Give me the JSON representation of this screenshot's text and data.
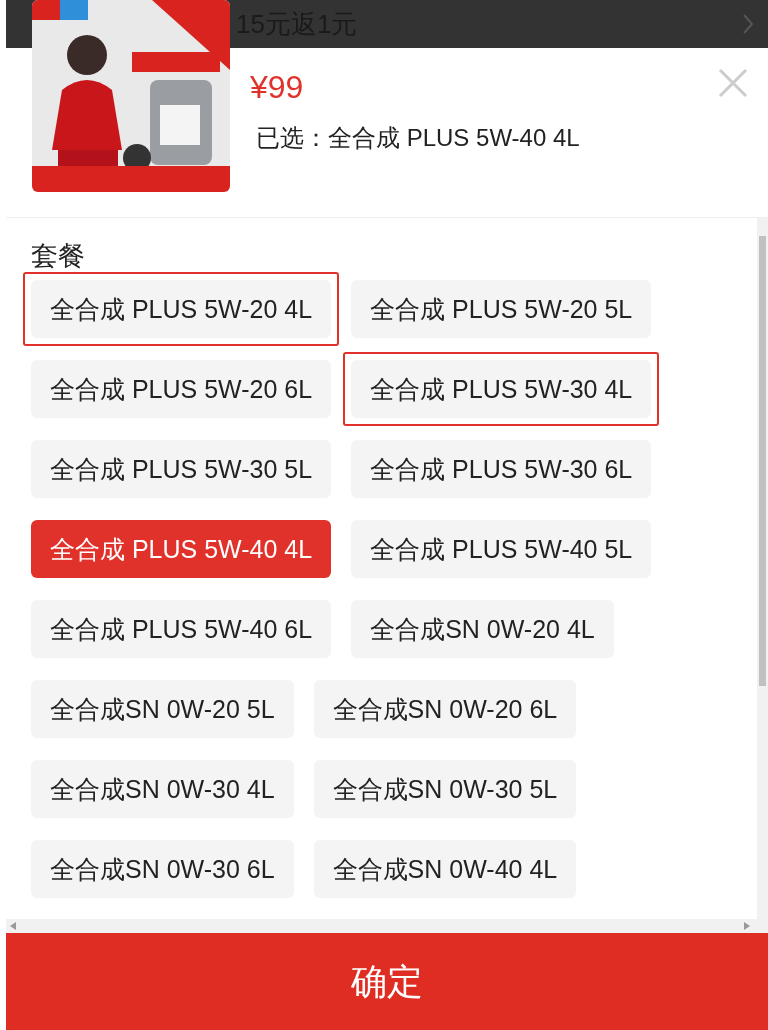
{
  "banner": {
    "text": "15元返1元"
  },
  "product": {
    "price": "¥99",
    "selected_text": "已选：全合成 PLUS 5W-40 4L"
  },
  "section_title": "套餐",
  "options": [
    {
      "label": "全合成 PLUS 5W-20 4L",
      "selected": false,
      "annotated": true
    },
    {
      "label": "全合成 PLUS 5W-20 5L",
      "selected": false,
      "annotated": false
    },
    {
      "label": "全合成 PLUS 5W-20 6L",
      "selected": false,
      "annotated": false
    },
    {
      "label": "全合成 PLUS 5W-30 4L",
      "selected": false,
      "annotated": true
    },
    {
      "label": "全合成 PLUS 5W-30 5L",
      "selected": false,
      "annotated": false
    },
    {
      "label": "全合成 PLUS 5W-30 6L",
      "selected": false,
      "annotated": false
    },
    {
      "label": "全合成 PLUS 5W-40 4L",
      "selected": true,
      "annotated": false
    },
    {
      "label": "全合成 PLUS 5W-40 5L",
      "selected": false,
      "annotated": false
    },
    {
      "label": "全合成 PLUS 5W-40 6L",
      "selected": false,
      "annotated": false
    },
    {
      "label": "全合成SN 0W-20 4L",
      "selected": false,
      "annotated": false
    },
    {
      "label": "全合成SN 0W-20 5L",
      "selected": false,
      "annotated": false
    },
    {
      "label": "全合成SN 0W-20 6L",
      "selected": false,
      "annotated": false
    },
    {
      "label": "全合成SN 0W-30 4L",
      "selected": false,
      "annotated": false
    },
    {
      "label": "全合成SN 0W-30 5L",
      "selected": false,
      "annotated": false
    },
    {
      "label": "全合成SN 0W-30 6L",
      "selected": false,
      "annotated": false
    },
    {
      "label": "全合成SN 0W-40 4L",
      "selected": false,
      "annotated": false
    }
  ],
  "confirm_button": "确定"
}
